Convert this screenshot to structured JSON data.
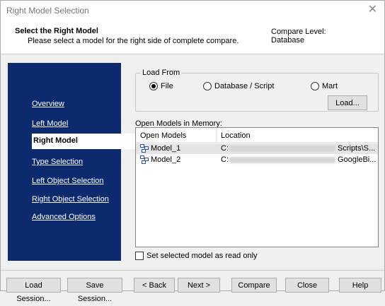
{
  "window": {
    "title": "Right Model Selection"
  },
  "header": {
    "title": "Select the Right Model",
    "subtitle": "Please select a model for the right side of complete compare.",
    "compare_label": "Compare Level:",
    "compare_value": "Database"
  },
  "nav": {
    "items": [
      {
        "label": "Overview",
        "active": false
      },
      {
        "label": "Left Model",
        "active": false
      },
      {
        "label": "Right Model",
        "active": true
      },
      {
        "label": "Type Selection",
        "active": false
      },
      {
        "label": "Left Object Selection",
        "active": false
      },
      {
        "label": "Right Object Selection",
        "active": false
      },
      {
        "label": "Advanced Options",
        "active": false
      }
    ]
  },
  "load_from": {
    "label": "Load From",
    "options": [
      {
        "label": "File",
        "selected": true
      },
      {
        "label": "Database / Script",
        "selected": false
      },
      {
        "label": "Mart",
        "selected": false
      }
    ],
    "load_button": "Load..."
  },
  "open_models": {
    "label": "Open Models in Memory:",
    "columns": [
      "Open Models",
      "Location"
    ],
    "rows": [
      {
        "name": "Model_1",
        "location_prefix": "C:",
        "location_suffix": "Scripts\\S..."
      },
      {
        "name": "Model_2",
        "location_prefix": "C:",
        "location_suffix": "GoogleBi..."
      }
    ]
  },
  "readonly_checkbox": {
    "label": "Set selected model as read only",
    "checked": false
  },
  "buttons": {
    "load_session": "Load Session...",
    "save_session": "Save Session...",
    "back": "< Back",
    "next": "Next >",
    "compare": "Compare",
    "close": "Close",
    "help": "Help"
  },
  "colors": {
    "nav_bg": "#0d2a6e",
    "window_bg": "#f0f0f0"
  },
  "icons": {
    "window_close": "close-icon",
    "model": "model-icon"
  }
}
